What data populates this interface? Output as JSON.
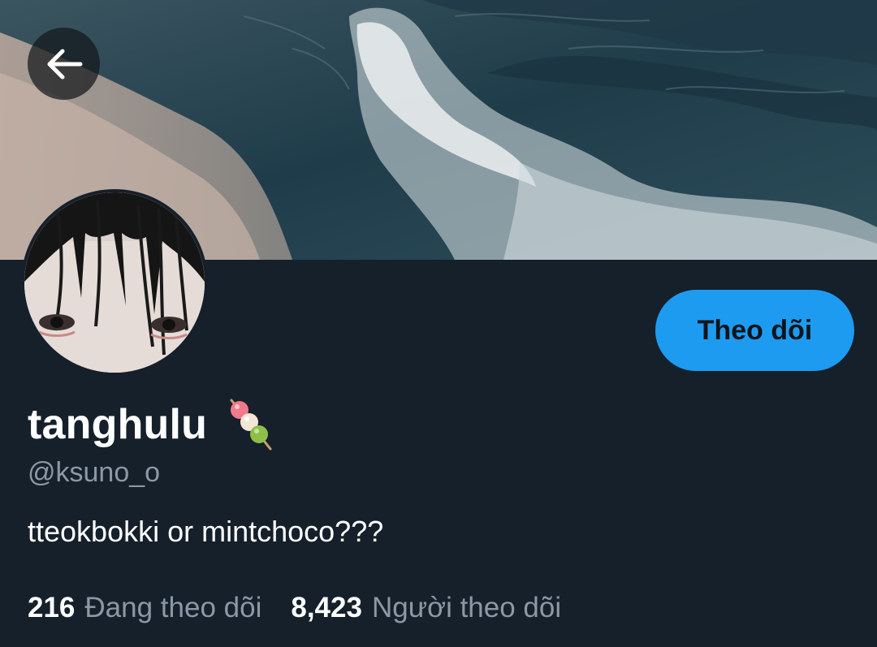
{
  "profile": {
    "display_name": "tanghulu",
    "handle": "@ksuno_o",
    "bio": "tteokbokki or mintchoco???",
    "name_emoji": "dango-icon"
  },
  "actions": {
    "back_icon": "arrow-left-icon",
    "follow_label": "Theo dõi"
  },
  "stats": {
    "following_count": "216",
    "following_label": "Đang theo dõi",
    "followers_count": "8,423",
    "followers_label": "Người theo dõi"
  },
  "colors": {
    "background": "#15202b",
    "accent": "#1d9bf0",
    "secondary_text": "#8b98a5",
    "primary_text": "#ffffff"
  }
}
